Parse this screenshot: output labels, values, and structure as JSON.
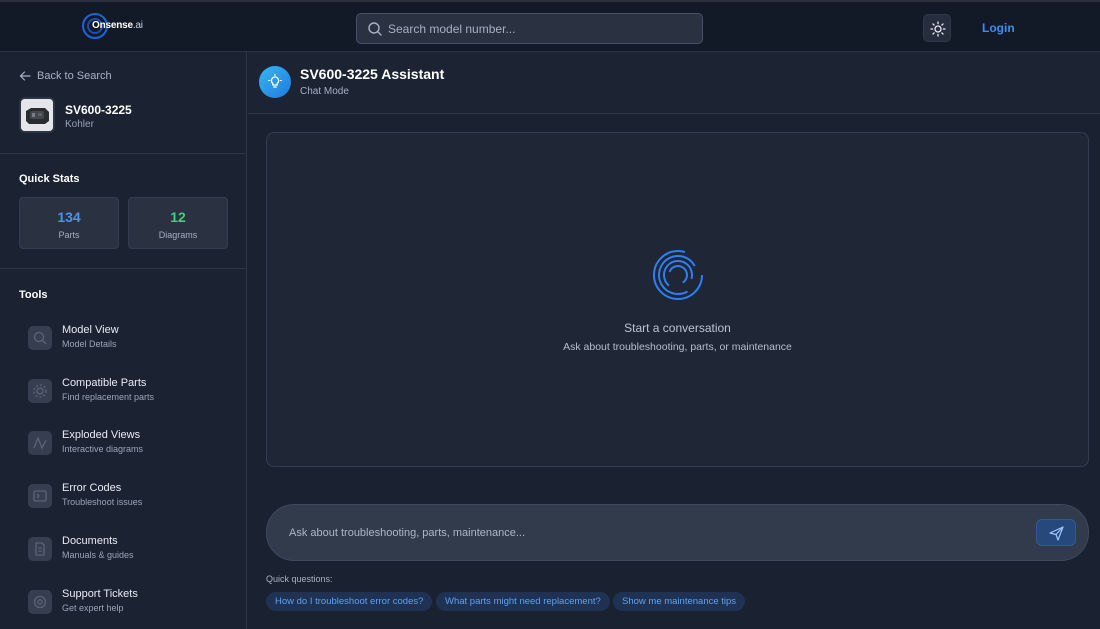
{
  "header": {
    "logo_text": "Onsense",
    "logo_suffix": ".ai",
    "search_placeholder": "Search model number...",
    "theme_toggle_icon": "sun-icon",
    "login_label": "Login",
    "accent_color": "#3d8cf0"
  },
  "sidebar": {
    "back_label": "Back to Search",
    "model": {
      "name": "SV600-3225",
      "brand": "Kohler"
    },
    "quick_stats_title": "Quick Stats",
    "stats": [
      {
        "value": "134",
        "label": "Parts",
        "color": "#4a94f0"
      },
      {
        "value": "12",
        "label": "Diagrams",
        "color": "#3ed27a"
      }
    ],
    "tools_title": "Tools",
    "tools": [
      {
        "name": "Model View",
        "desc": "Model Details",
        "icon": "search-icon"
      },
      {
        "name": "Compatible Parts",
        "desc": "Find replacement parts",
        "icon": "gear-icon"
      },
      {
        "name": "Exploded Views",
        "desc": "Interactive diagrams",
        "icon": "diagram-icon"
      },
      {
        "name": "Error Codes",
        "desc": "Troubleshoot issues",
        "icon": "terminal-icon"
      },
      {
        "name": "Documents",
        "desc": "Manuals & guides",
        "icon": "document-icon"
      },
      {
        "name": "Support Tickets",
        "desc": "Get expert help",
        "icon": "support-icon"
      }
    ]
  },
  "chat": {
    "title": "SV600-3225 Assistant",
    "mode": "Chat Mode",
    "empty_title": "Start a conversation",
    "empty_subtitle": "Ask about troubleshooting, parts, or maintenance",
    "input_placeholder": "Ask about troubleshooting, parts, maintenance...",
    "quick_label": "Quick questions:",
    "quick_questions": [
      "How do I troubleshoot error codes?",
      "What parts might need replacement?",
      "Show me maintenance tips"
    ]
  }
}
